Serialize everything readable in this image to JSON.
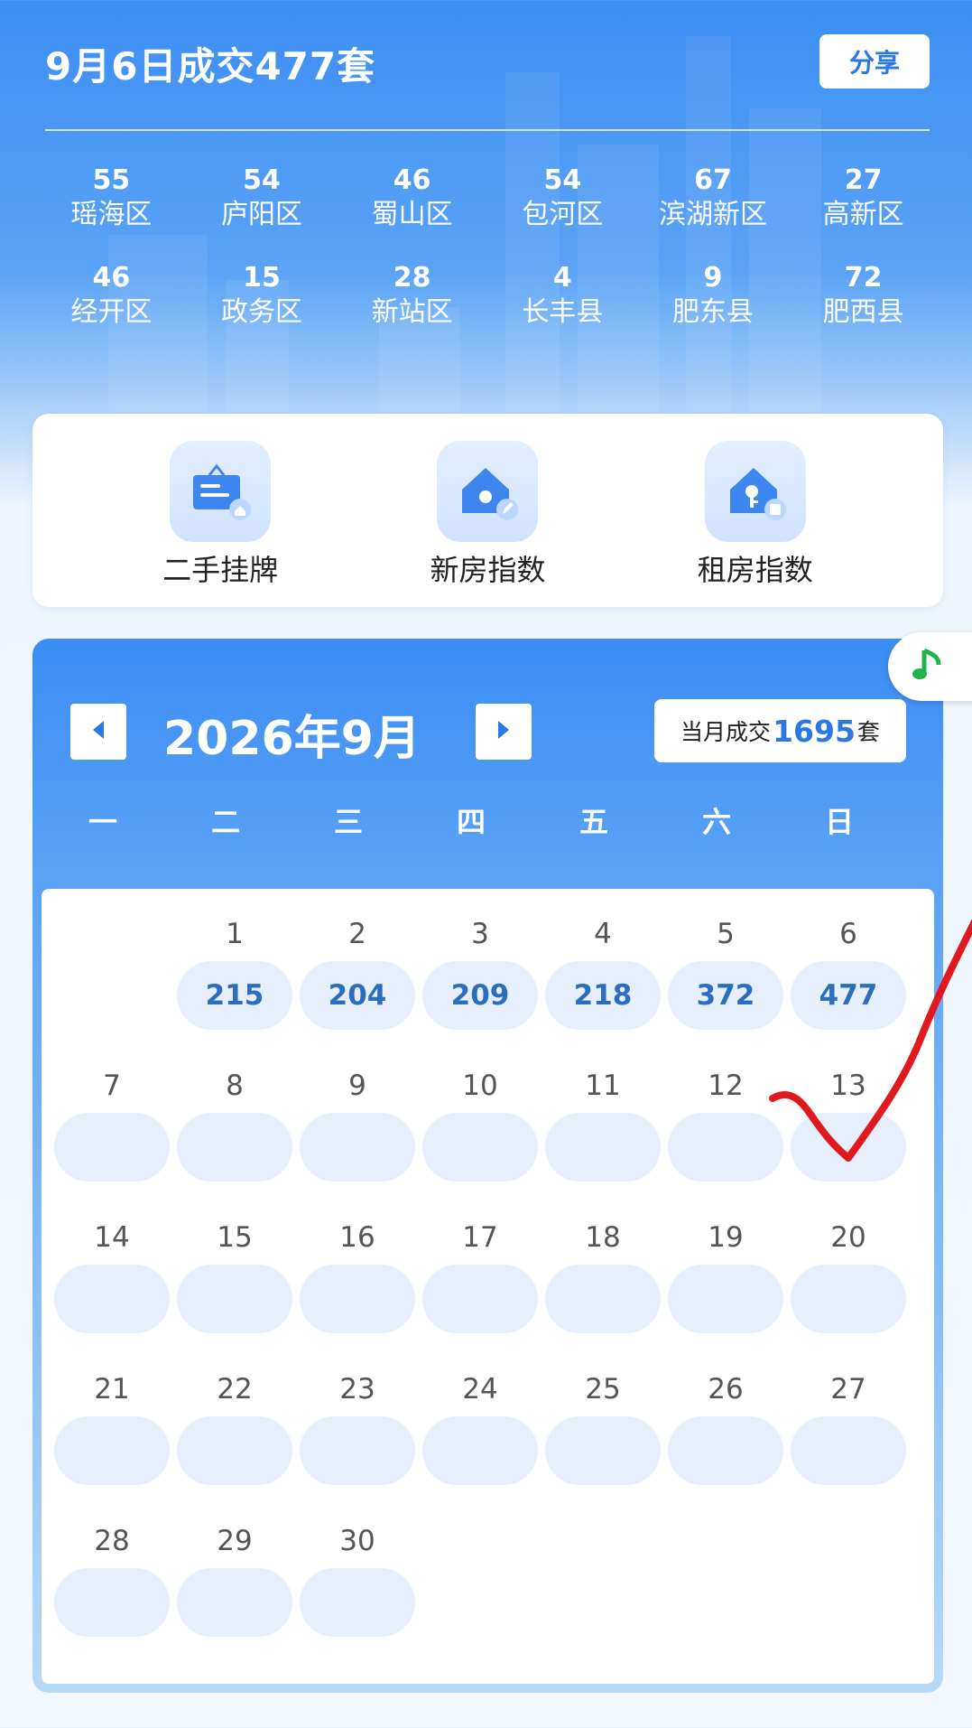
{
  "header": {
    "headline": "9月6日成交477套",
    "share_label": "分享"
  },
  "districts": [
    {
      "count": "55",
      "name": "瑶海区"
    },
    {
      "count": "54",
      "name": "庐阳区"
    },
    {
      "count": "46",
      "name": "蜀山区"
    },
    {
      "count": "54",
      "name": "包河区"
    },
    {
      "count": "67",
      "name": "滨湖新区"
    },
    {
      "count": "27",
      "name": "高新区"
    },
    {
      "count": "46",
      "name": "经开区"
    },
    {
      "count": "15",
      "name": "政务区"
    },
    {
      "count": "28",
      "name": "新站区"
    },
    {
      "count": "4",
      "name": "长丰县"
    },
    {
      "count": "9",
      "name": "肥东县"
    },
    {
      "count": "72",
      "name": "肥西县"
    }
  ],
  "shortcuts": [
    {
      "label": "二手挂牌",
      "icon": "signboard-icon"
    },
    {
      "label": "新房指数",
      "icon": "house-edit-icon"
    },
    {
      "label": "租房指数",
      "icon": "house-key-icon"
    }
  ],
  "calendar": {
    "title": "2026年9月",
    "month_total_prefix": "当月成交",
    "month_total_value": "1695",
    "month_total_suffix": "套",
    "weekdays": [
      "一",
      "二",
      "三",
      "四",
      "五",
      "六",
      "日"
    ],
    "days": [
      {
        "day": "",
        "value": ""
      },
      {
        "day": "1",
        "value": "215"
      },
      {
        "day": "2",
        "value": "204"
      },
      {
        "day": "3",
        "value": "209"
      },
      {
        "day": "4",
        "value": "218"
      },
      {
        "day": "5",
        "value": "372"
      },
      {
        "day": "6",
        "value": "477"
      },
      {
        "day": "7",
        "value": ""
      },
      {
        "day": "8",
        "value": ""
      },
      {
        "day": "9",
        "value": ""
      },
      {
        "day": "10",
        "value": ""
      },
      {
        "day": "11",
        "value": ""
      },
      {
        "day": "12",
        "value": ""
      },
      {
        "day": "13",
        "value": ""
      },
      {
        "day": "14",
        "value": ""
      },
      {
        "day": "15",
        "value": ""
      },
      {
        "day": "16",
        "value": ""
      },
      {
        "day": "17",
        "value": ""
      },
      {
        "day": "18",
        "value": ""
      },
      {
        "day": "19",
        "value": ""
      },
      {
        "day": "20",
        "value": ""
      },
      {
        "day": "21",
        "value": ""
      },
      {
        "day": "22",
        "value": ""
      },
      {
        "day": "23",
        "value": ""
      },
      {
        "day": "24",
        "value": ""
      },
      {
        "day": "25",
        "value": ""
      },
      {
        "day": "26",
        "value": ""
      },
      {
        "day": "27",
        "value": ""
      },
      {
        "day": "28",
        "value": ""
      },
      {
        "day": "29",
        "value": ""
      },
      {
        "day": "30",
        "value": ""
      }
    ]
  },
  "colors": {
    "brand_blue": "#3d8ef3",
    "value_blue": "#2b6ec0",
    "pill_bg": "#e6effb",
    "check_red": "#e0191f"
  },
  "floating": {
    "icon": "music-note-icon"
  },
  "annotation": {
    "icon": "red-checkmark-icon"
  }
}
